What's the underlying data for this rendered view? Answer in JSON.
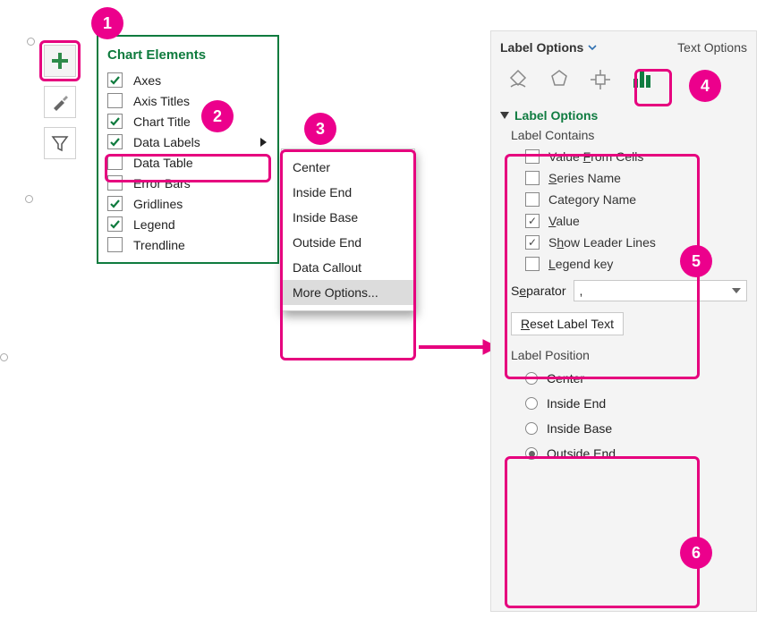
{
  "badges": {
    "b1": "1",
    "b2": "2",
    "b3": "3",
    "b4": "4",
    "b5": "5",
    "b6": "6"
  },
  "chartElements": {
    "title": "Chart Elements",
    "items": [
      {
        "label": "Axes",
        "checked": true,
        "arrow": false
      },
      {
        "label": "Axis Titles",
        "checked": false,
        "arrow": false
      },
      {
        "label": "Chart Title",
        "checked": true,
        "arrow": false
      },
      {
        "label": "Data Labels",
        "checked": true,
        "arrow": true
      },
      {
        "label": "Data Table",
        "checked": false,
        "arrow": false
      },
      {
        "label": "Error Bars",
        "checked": false,
        "arrow": false
      },
      {
        "label": "Gridlines",
        "checked": true,
        "arrow": false
      },
      {
        "label": "Legend",
        "checked": true,
        "arrow": false
      },
      {
        "label": "Trendline",
        "checked": false,
        "arrow": false
      }
    ]
  },
  "submenu": {
    "items": [
      {
        "label": "Center",
        "hl": false
      },
      {
        "label": "Inside End",
        "hl": false
      },
      {
        "label": "Inside Base",
        "hl": false
      },
      {
        "label": "Outside End",
        "hl": false
      },
      {
        "label": "Data Callout",
        "hl": false
      },
      {
        "label": "More Options...",
        "hl": true
      }
    ]
  },
  "pane": {
    "tabs": {
      "active": "Label Options",
      "inactive": "Text Options"
    },
    "sectionTitle": "Label Options",
    "labelContains": {
      "title": "Label Contains",
      "opts": [
        {
          "pre": "Value ",
          "ul": "F",
          "post": "rom Cells",
          "checked": false
        },
        {
          "pre": "",
          "ul": "S",
          "post": "eries Name",
          "checked": false
        },
        {
          "pre": "Cate",
          "ul": "g",
          "post": "ory Name",
          "checked": false
        },
        {
          "pre": "",
          "ul": "V",
          "post": "alue",
          "checked": true
        },
        {
          "pre": "S",
          "ul": "h",
          "post": "ow Leader Lines",
          "checked": true
        },
        {
          "pre": "",
          "ul": "L",
          "post": "egend key",
          "checked": false
        }
      ]
    },
    "separator": {
      "label_pre": "S",
      "label_ul": "e",
      "label_post": "parator",
      "value": ","
    },
    "reset": {
      "pre": "",
      "ul": "R",
      "post": "eset Label Text"
    },
    "labelPosition": {
      "title": "Label Position",
      "opts": [
        {
          "pre": "",
          "ul": "C",
          "post": "enter",
          "selected": false
        },
        {
          "pre": "",
          "ul": "I",
          "post": "nside End",
          "selected": false
        },
        {
          "pre": "Insi",
          "ul": "d",
          "post": "e Base",
          "selected": false
        },
        {
          "pre": "",
          "ul": "O",
          "post": "utside End",
          "selected": true
        }
      ]
    }
  }
}
